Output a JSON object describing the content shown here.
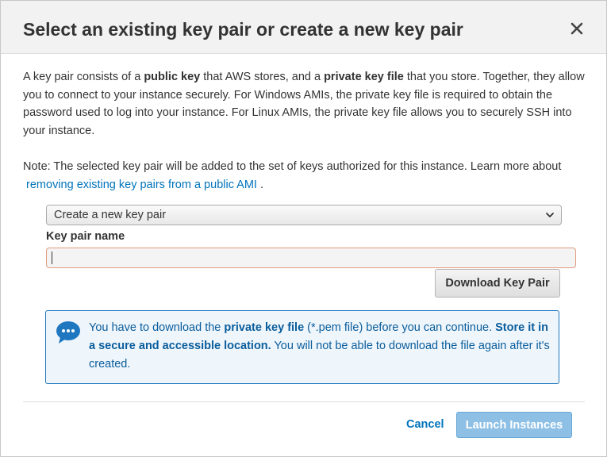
{
  "dialog": {
    "title": "Select an existing key pair or create a new key pair",
    "close_icon": "close-icon"
  },
  "intro": {
    "part1": "A key pair consists of a ",
    "bold1": "public key",
    "part2": " that AWS stores, and a ",
    "bold2": "private key file",
    "part3": " that you store. Together, they allow you to connect to your instance securely. For Windows AMIs, the private key file is required to obtain the password used to log into your instance. For Linux AMIs, the private key file allows you to securely SSH into your instance."
  },
  "note": {
    "text": "Note: The selected key pair will be added to the set of keys authorized for this instance. Learn more about",
    "link": "removing existing key pairs from a public AMI",
    "end": "."
  },
  "key_pair_select": {
    "selected": "Create a new key pair",
    "icon": "chevron-down-icon"
  },
  "key_pair_name": {
    "label": "Key pair name",
    "value": ""
  },
  "download_button": "Download Key Pair",
  "info": {
    "icon": "chat-bubble-icon",
    "part1": "You have to download the ",
    "bold1": "private key file",
    "part2": " (*.pem file) before you can continue. ",
    "bold2": "Store it in a secure and accessible location.",
    "part3": " You will not be able to download the file again after it's created."
  },
  "footer": {
    "cancel": "Cancel",
    "launch": "Launch Instances"
  },
  "colors": {
    "link": "#0073bb",
    "info_border": "#1f77c0",
    "info_bg": "#eef5fb",
    "launch_disabled": "#8ec0e6",
    "input_error_border": "#e29b80"
  }
}
